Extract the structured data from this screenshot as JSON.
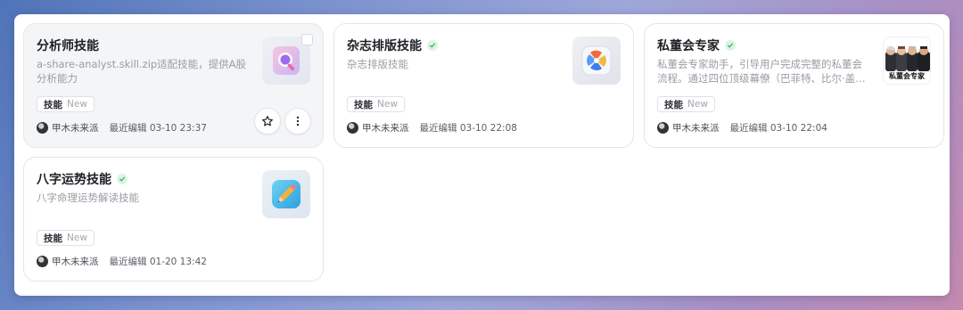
{
  "cards": [
    {
      "title": "分析师技能",
      "description": "a-share-analyst.skill.zip适配技能，提供A股分析能力",
      "tag": "技能",
      "tag_badge": "New",
      "author": "甲木未来派",
      "edited": "最近编辑 03-10 23:37",
      "verified": false,
      "icon": "magnifier-app-icon"
    },
    {
      "title": "杂志排版技能",
      "description": "杂志排版技能",
      "tag": "技能",
      "tag_badge": "New",
      "author": "甲木未来派",
      "edited": "最近编辑 03-10 22:08",
      "verified": true,
      "icon": "pinwheel-app-icon"
    },
    {
      "title": "私董会专家",
      "description": "私董会专家助手，引导用户完成完整的私董会流程。通过四位顶级幕僚（巴菲特、比尔·盖…",
      "tag": "技能",
      "tag_badge": "New",
      "author": "甲木未来派",
      "edited": "最近编辑 03-10 22:04",
      "verified": true,
      "icon": "board-members-photo",
      "thumb_label": "私董会专家"
    },
    {
      "title": "八字运势技能",
      "description": "八字命理运势解读技能",
      "tag": "技能",
      "tag_badge": "New",
      "author": "甲木未来派",
      "edited": "最近编辑 01-20 13:42",
      "verified": true,
      "icon": "pencil-app-icon"
    }
  ],
  "colors": {
    "verified_green": "#2fb866",
    "card_border": "#e3e5ea",
    "muted_text": "#9a9ca3"
  }
}
